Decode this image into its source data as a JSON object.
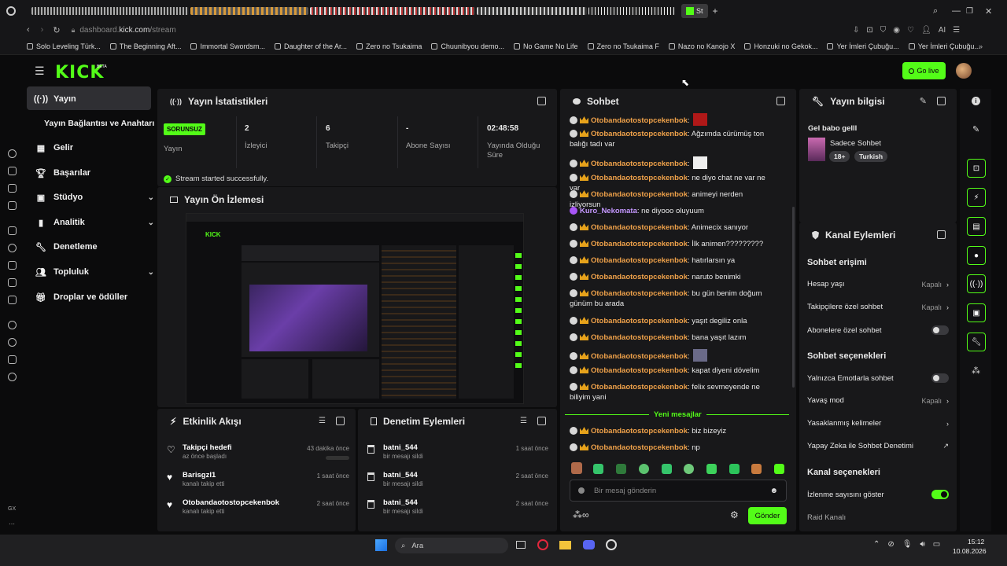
{
  "browser": {
    "tab_label": "St",
    "url_prefix": "dashboard.",
    "url_domain": "kick.com",
    "url_path": "/stream",
    "ai_label": "AI",
    "bookmarks": [
      "Solo Leveling Türk...",
      "The Beginning Aft...",
      "Immortal Swordsm...",
      "Daughter of the Ar...",
      "Zero no Tsukaima",
      "Chuunibyou demo...",
      "No Game No Life",
      "Zero no Tsukaima F",
      "Nazo no Kanojo X",
      "Honzuki no Gekok...",
      "Yer İmleri Çubuğu...",
      "Yer İmleri Çubuğu..."
    ]
  },
  "header": {
    "logo": "KICK",
    "beta": "BETA",
    "go_live": "Go live"
  },
  "sidebar": {
    "items": [
      {
        "label": "Yayın",
        "icon": "broadcast-icon"
      },
      {
        "label": "Yayın Bağlantısı ve Anahtarı"
      },
      {
        "label": "Gelir",
        "icon": "chart-icon"
      },
      {
        "label": "Başarılar",
        "icon": "trophy-icon"
      },
      {
        "label": "Stüdyo",
        "icon": "studio-icon"
      },
      {
        "label": "Analitik",
        "icon": "analytics-icon"
      },
      {
        "label": "Denetleme",
        "icon": "wrench-icon"
      },
      {
        "label": "Topluluk",
        "icon": "community-icon"
      },
      {
        "label": "Droplar ve ödüller",
        "icon": "gift-icon"
      }
    ],
    "rail_bottom_label": "GX"
  },
  "stats": {
    "title": "Yayın İstatistikleri",
    "status_badge": "SORUNSUZ",
    "status_label": "Yayın",
    "viewers_value": "2",
    "viewers_label": "İzleyici",
    "followers_value": "6",
    "followers_label": "Takipçi",
    "subs_value": "-",
    "subs_label": "Abone Sayısı",
    "uptime_value": "02:48:58",
    "uptime_label": "Yayında Olduğu Süre",
    "success_msg": "Stream started successfully."
  },
  "preview": {
    "title": "Yayın Ön İzlemesi"
  },
  "activity": {
    "title": "Etkinlik Akışı",
    "items": [
      {
        "name": "Takipçi hedefi",
        "sub": "az önce başladı",
        "time": "43 dakika önce"
      },
      {
        "name": "Barisgzl1",
        "sub": "kanalı takip etti",
        "time": "1 saat önce"
      },
      {
        "name": "Otobandaotostopcekenbok",
        "sub": "kanalı takip etti",
        "time": "2 saat önce"
      }
    ]
  },
  "moderation": {
    "title": "Denetim Eylemleri",
    "items": [
      {
        "name": "batni_544",
        "sub": "bir mesajı sildi",
        "time": "1 saat önce"
      },
      {
        "name": "batni_544",
        "sub": "bir mesajı sildi",
        "time": "2 saat önce"
      },
      {
        "name": "batni_544",
        "sub": "bir mesajı sildi",
        "time": "2 saat önce"
      }
    ]
  },
  "chat": {
    "title": "Sohbet",
    "messages": [
      {
        "user": "Otobandaotostopcekenbok",
        "text": ":"
      },
      {
        "user": "Otobandaotostopcekenbok",
        "text": ": Ağzımda cürümüş ton balığı tadı var"
      },
      {
        "user": "Otobandaotostopcekenbok",
        "text": ":"
      },
      {
        "user": "Otobandaotostopcekenbok",
        "text": ": ne diyo chat ne var ne var"
      },
      {
        "user": "Otobandaotostopcekenbok",
        "text": ": animeyi nerden izliyorsun"
      },
      {
        "user": "Kuro_Nekomata",
        "text": ": ne diyooo oluyuum"
      },
      {
        "user": "Otobandaotostopcekenbok",
        "text": ": Animecix sanıyor"
      },
      {
        "user": "Otobandaotostopcekenbok",
        "text": ": İlk animen?????????"
      },
      {
        "user": "Otobandaotostopcekenbok",
        "text": ": hatırlarsın ya"
      },
      {
        "user": "Otobandaotostopcekenbok",
        "text": ": naruto benimki"
      },
      {
        "user": "Otobandaotostopcekenbok",
        "text": ": bu gün benim doğum günüm bu arada"
      },
      {
        "user": "Otobandaotostopcekenbok",
        "text": ": yaşıt degiliz onla"
      },
      {
        "user": "Otobandaotostopcekenbok",
        "text": ": bana yaşıt lazım"
      },
      {
        "user": "Otobandaotostopcekenbok",
        "text": ":"
      },
      {
        "user": "Otobandaotostopcekenbok",
        "text": ": kapat diyeni dövelim"
      },
      {
        "user": "Otobandaotostopcekenbok",
        "text": ": felix sevmeyende ne biliyim yani"
      },
      {
        "user": "Otobandaotostopcekenbok",
        "text": ": biz bizeyiz"
      },
      {
        "user": "Otobandaotostopcekenbok",
        "text": ": np"
      }
    ],
    "new_messages": "Yeni mesajlar",
    "input_placeholder": "Bir mesaj gönderin",
    "send": "Gönder"
  },
  "stream_info": {
    "title": "Yayın bilgisi",
    "stream_title": "Gel babo gelll",
    "category": "Sadece Sohbet",
    "tags": [
      "18+",
      "Turkish"
    ]
  },
  "channel_actions": {
    "title": "Kanal Eylemleri",
    "chat_access": "Sohbet erişimi",
    "account_age": "Hesap yaşı",
    "account_age_value": "Kapalı",
    "followers_only": "Takipçilere özel sohbet",
    "followers_only_value": "Kapalı",
    "subs_only": "Abonelere özel sohbet",
    "chat_options": "Sohbet seçenekleri",
    "emotes_only": "Yalnızca Emotlarla sohbet",
    "slow_mode": "Yavaş mod",
    "slow_mode_value": "Kapalı",
    "banned_words": "Yasaklanmış kelimeler",
    "ai_moderation": "Yapay Zeka ile Sohbet Denetimi",
    "channel_options": "Kanal seçenekleri",
    "show_viewers": "İzlenme sayısını göster",
    "raid": "Raid Kanalı"
  },
  "taskbar": {
    "search": "Ara",
    "time": "15:12",
    "date": "10.08.2026"
  },
  "colors": {
    "accent": "#53fc18",
    "username": "#f0a24a",
    "bg": "#0b0b0c",
    "panel": "#18181a"
  }
}
